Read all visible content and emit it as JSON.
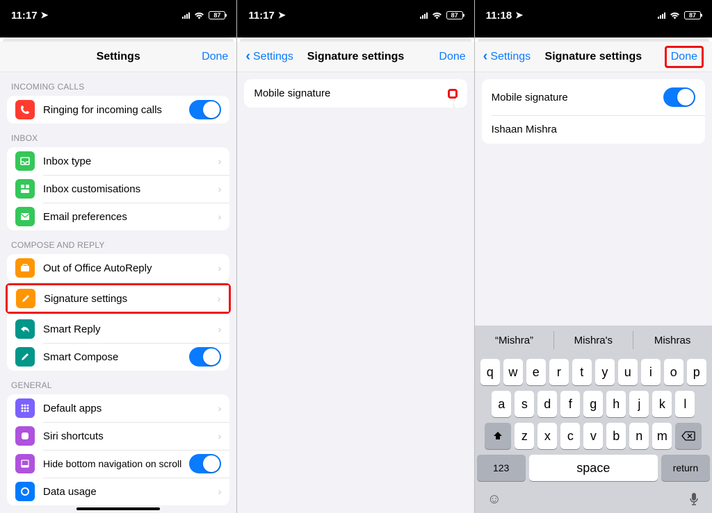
{
  "screens": [
    {
      "statusbar": {
        "time": "11:17",
        "battery": "87"
      },
      "nav": {
        "title": "Settings",
        "right": "Done"
      },
      "sections": [
        {
          "header": "INCOMING CALLS",
          "rows": [
            {
              "label": "Ringing for incoming calls",
              "iconColor": "red",
              "toggle": true,
              "toggleOn": true
            }
          ]
        },
        {
          "header": "INBOX",
          "rows": [
            {
              "label": "Inbox type",
              "iconColor": "green"
            },
            {
              "label": "Inbox customisations",
              "iconColor": "green"
            },
            {
              "label": "Email preferences",
              "iconColor": "green"
            }
          ]
        },
        {
          "header": "COMPOSE AND REPLY",
          "rows": [
            {
              "label": "Out of Office AutoReply",
              "iconColor": "orange"
            },
            {
              "label": "Signature settings",
              "iconColor": "orange",
              "highlight": true
            },
            {
              "label": "Smart Reply",
              "iconColor": "teal"
            },
            {
              "label": "Smart Compose",
              "iconColor": "teal",
              "toggle": true,
              "toggleOn": true
            }
          ]
        },
        {
          "header": "GENERAL",
          "rows": [
            {
              "label": "Default apps",
              "iconColor": "dpurple"
            },
            {
              "label": "Siri shortcuts",
              "iconColor": "purple"
            },
            {
              "label": "Hide bottom navigation on scroll",
              "iconColor": "purple",
              "toggle": true,
              "toggleOn": true
            },
            {
              "label": "Data usage",
              "iconColor": "blue"
            }
          ]
        }
      ]
    },
    {
      "statusbar": {
        "time": "11:17",
        "battery": "87"
      },
      "nav": {
        "back": "Settings",
        "title": "Signature settings",
        "right": "Done"
      },
      "mobileSignature": {
        "label": "Mobile signature",
        "on": false,
        "highlightToggle": true
      }
    },
    {
      "statusbar": {
        "time": "11:18",
        "battery": "87"
      },
      "nav": {
        "back": "Settings",
        "title": "Signature settings",
        "right": "Done",
        "highlightRight": true
      },
      "mobileSignature": {
        "label": "Mobile signature",
        "on": true
      },
      "signatureText": "Ishaan Mishra",
      "keyboard": {
        "suggestions": [
          "“Mishra”",
          "Mishra's",
          "Mishras"
        ],
        "row1": [
          "q",
          "w",
          "e",
          "r",
          "t",
          "y",
          "u",
          "i",
          "o",
          "p"
        ],
        "row2": [
          "a",
          "s",
          "d",
          "f",
          "g",
          "h",
          "j",
          "k",
          "l"
        ],
        "row3": [
          "z",
          "x",
          "c",
          "v",
          "b",
          "n",
          "m"
        ],
        "numKey": "123",
        "spaceKey": "space",
        "returnKey": "return"
      }
    }
  ]
}
